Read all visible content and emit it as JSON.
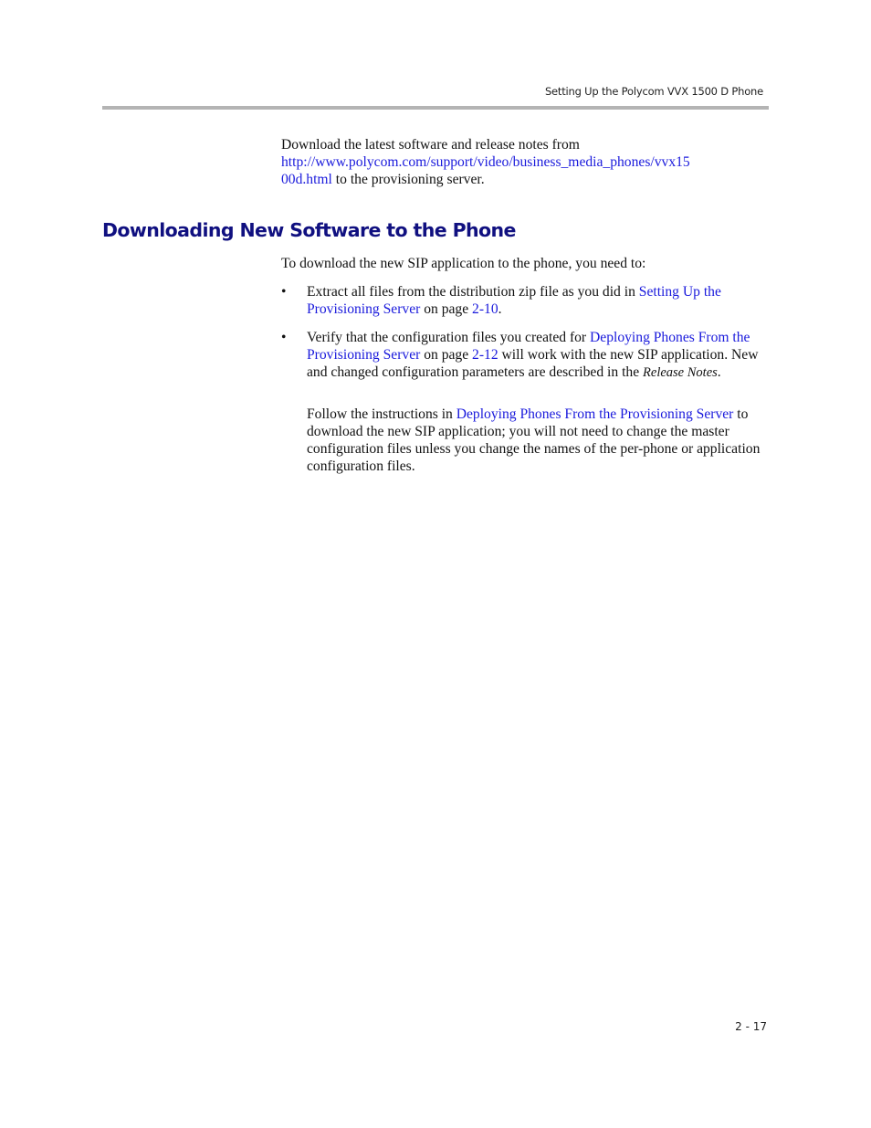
{
  "header": {
    "running_title": "Setting Up the Polycom VVX 1500 D Phone"
  },
  "intro": {
    "text_before": "Download the latest software and release notes from",
    "link_text_line1": "http://www.polycom.com/support/video/business_media_phones/vvx15",
    "link_text_line2": "00d.html",
    "text_after": " to the provisioning server."
  },
  "section": {
    "title": "Downloading New Software to the Phone",
    "lead": "To download the new SIP application to the phone, you need to:",
    "bullet_glyph": "•",
    "bullets": [
      {
        "text_before": "Extract all files from the distribution zip file as you did in ",
        "link_text": "Setting Up the Provisioning Server",
        "mid_text": " on page ",
        "page_link": "2-10",
        "text_after": "."
      },
      {
        "text_before": "Verify that the configuration files you created for ",
        "link_text": "Deploying Phones From the Provisioning Server",
        "mid_text": " on page ",
        "page_link": "2-12",
        "text_after": " will work with the new SIP application. New and changed configuration parameters are described in the ",
        "italic_text": "Release Notes",
        "end_text": "."
      }
    ],
    "follow_up": {
      "text_before": "Follow the instructions in ",
      "link_text": "Deploying Phones From the Provisioning Server",
      "text_after": " to download the new SIP application; you will not need to change the master configuration files unless you change the names of the per-phone or application configuration files."
    }
  },
  "footer": {
    "page_number": "2 - 17"
  },
  "colors": {
    "heading": "#101080",
    "link": "#1a1adc",
    "rule": "#b4b4b4"
  }
}
